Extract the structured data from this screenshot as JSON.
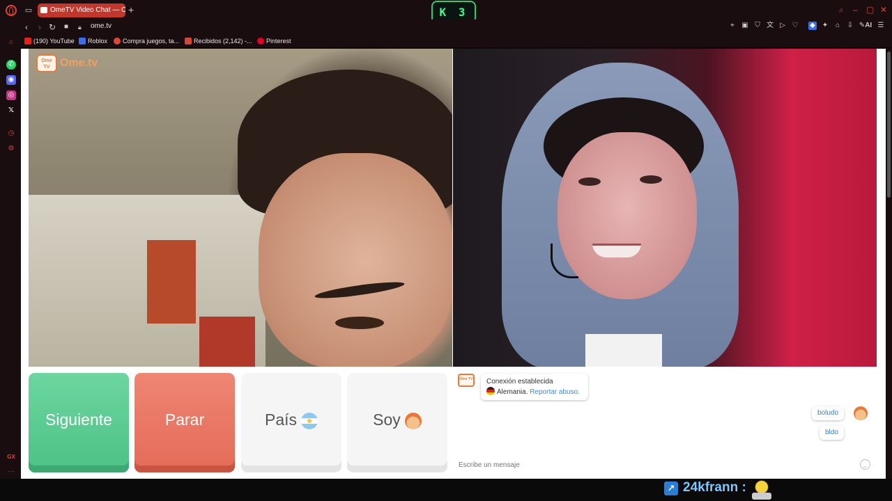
{
  "browser": {
    "tab_title": "OmeTV Video Chat — O",
    "new_tab_label": "+",
    "url": "ome.tv",
    "badge_text": "K 3",
    "bookmarks": [
      {
        "label": "(190) YouTube",
        "color": "#e62117"
      },
      {
        "label": "Roblox",
        "color": "#3b6ee8"
      },
      {
        "label": "Compra juegos, ta...",
        "color": "#e0453a"
      },
      {
        "label": "Recibidos (2,142) -...",
        "color": "#d44638"
      },
      {
        "label": "Pinterest",
        "color": "#e60023"
      }
    ],
    "toolbar_ai_label": "AI",
    "sidebar_gx_label": "GX",
    "accent_color": "#e0453a"
  },
  "ometv": {
    "logo_small": "Ome TV",
    "logo_text": "Ome.tv",
    "buttons": {
      "next": "Siguiente",
      "stop": "Parar",
      "country": "País",
      "me": "Soy"
    },
    "chat": {
      "system_title": "Conexión establecida",
      "system_country": "Alemania.",
      "report_link": "Reportar abuso.",
      "messages": [
        "boludo",
        "bldo"
      ],
      "input_placeholder": "Escribe un mensaje"
    }
  },
  "overlay": {
    "streamer_name": "24kfrann :",
    "platform_icon": "kick-icon"
  }
}
